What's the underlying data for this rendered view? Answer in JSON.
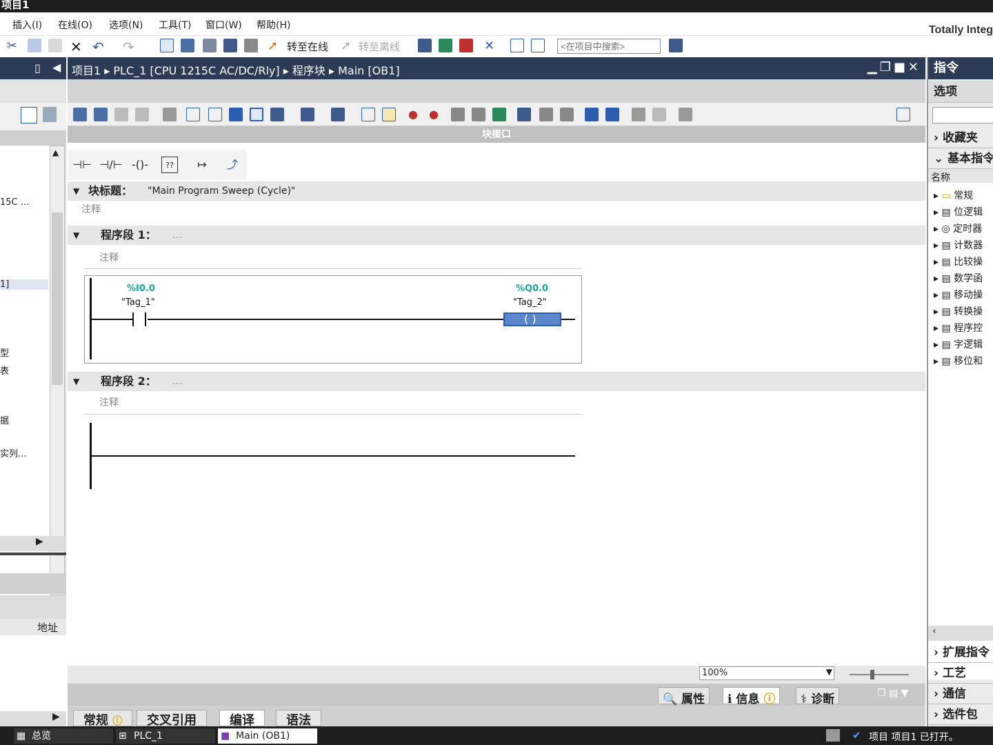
{
  "window": {
    "title": "项目1"
  },
  "menu": {
    "items": [
      "插入(I)",
      "在线(O)",
      "选项(N)",
      "工具(T)",
      "窗口(W)",
      "帮助(H)"
    ],
    "brand": "Totally Integ"
  },
  "toolbar": {
    "go_online": "转至在线",
    "go_offline": "转至离线",
    "search_placeholder": "<在项目中搜索>"
  },
  "left_panel": {
    "rows": [
      "15C ...",
      "1]",
      "型",
      "表",
      "据",
      "实列...",
      "地址"
    ]
  },
  "editor": {
    "breadcrumb": [
      "项目1",
      "PLC_1 [CPU 1215C AC/DC/Rly]",
      "程序块",
      "Main [OB1]"
    ],
    "interface_label": "块接口",
    "block_title_label": "块标题：",
    "block_title_value": "\"Main Program Sweep (Cycle)\"",
    "comment_label": "注释",
    "networks": [
      {
        "label": "程序段 1：",
        "dots": "....",
        "comment": "注释",
        "contact": {
          "address": "%I0.0",
          "tag": "\"Tag_1\""
        },
        "coil": {
          "address": "%Q0.0",
          "tag": "\"Tag_2\""
        }
      },
      {
        "label": "程序段 2：",
        "dots": "....",
        "comment": "注释"
      }
    ],
    "zoom": "100%"
  },
  "inspector": {
    "tabs": [
      "属性",
      "信息",
      "诊断"
    ]
  },
  "property_tabs": [
    "常规",
    "交叉引用",
    "编译",
    "语法"
  ],
  "right_panel": {
    "title": "指令",
    "options": "选项",
    "favorites": "收藏夹",
    "basic": "基本指令",
    "name_col": "名称",
    "items": [
      "常规",
      "位逻辑",
      "定时器",
      "计数器",
      "比较操",
      "数学函",
      "移动操",
      "转换操",
      "程序控",
      "字逻辑",
      "移位和"
    ],
    "extended": "扩展指令",
    "technology": "工艺",
    "communication": "通信",
    "optional": "选件包"
  },
  "statusbar": {
    "overview": "总览",
    "plc": "PLC_1",
    "main": "Main (OB1)",
    "message": "项目 项目1 已打开。"
  }
}
